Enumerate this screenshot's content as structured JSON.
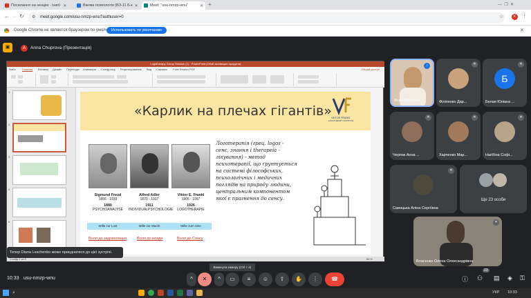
{
  "browser": {
    "tabs": [
      {
        "title": "Посилання на зенцію - ivanl·",
        "active": false,
        "color": "#d93025"
      },
      {
        "title": "Вікова психологія (ВЗ-11 Б.к",
        "active": false,
        "color": "#1a73e8"
      },
      {
        "title": "Meet: \"usu-nmzp-wnu\"",
        "active": true,
        "color": "#00897b"
      }
    ],
    "new_tab": "+",
    "url": "meet.google.com/usu-nmzp-wnu?authuser=0",
    "infobar": {
      "message": "Google Chrome не является браузером по умолчанию",
      "button": "Использовать по умолчанию"
    },
    "profile_letter": "К"
  },
  "meet": {
    "presenter_letter": "A",
    "presenter_label": "Anna Chuprova (Презентація)",
    "meeting_time": "10:33",
    "meeting_code": "usu-nmzp-wnu",
    "participants_count": "23",
    "toast": "Тепер Diana Leschenko може приєднатися до цієї зустрічі.",
    "tooltip": "Вимкнути камеру (Ctrl + e)",
    "more_people": "Ще 23 особи",
    "tiles": [
      {
        "name": "Anna Chuprova",
        "type": "video",
        "bg": "#d9c7b3"
      },
      {
        "name": "Філіпенко Дар...",
        "type": "photo",
        "bg": "#4a4f55"
      },
      {
        "name": "Белая Юліана ...",
        "type": "letter",
        "letter": "Б",
        "bg": "#1a73e8"
      },
      {
        "name": "Черпак Анна ...",
        "type": "photo",
        "bg": "#5b4c48"
      },
      {
        "name": "Харченко Мар...",
        "type": "photo",
        "bg": "#6b5548"
      },
      {
        "name": "Нагібіна Софі...",
        "type": "photo",
        "bg": "#7a6a58"
      },
      {
        "name": "Савоцька Аліна Сергіївна",
        "type": "photo",
        "bg": "#3d3a33"
      },
      {
        "name": "Власенко Олена Олександрівна",
        "type": "video",
        "bg": "#8a8478"
      }
    ]
  },
  "powerpoint": {
    "title": "Logotherapy Group Session (1) - PowerPoint (Сбой активации продукта)",
    "ribbon_tabs": [
      "Файл",
      "Главная",
      "Вставка",
      "Дизайн",
      "Переходы",
      "Анимация",
      "Слайд-шоу",
      "Рецензирование",
      "Вид",
      "Справка",
      "Foxit Reader PDF"
    ],
    "share": "Общий доступ",
    "slide_numbers": [
      "1",
      "2",
      "3",
      "4",
      "5"
    ],
    "status_left": "Слайд 2 из 9",
    "zoom": "85 %"
  },
  "slide": {
    "title": "«Карлик на плечах гігантів»",
    "logo_text": "VIKTOR FRANKL",
    "logo_sub": "LOGOTHERAPY INSTITUTE",
    "people": [
      {
        "name": "Sigmund Freud",
        "years": "1856 - 1939",
        "school_year": "1880",
        "school": "PSYCHOANALYSE",
        "will": "Wille zur Lust",
        "link": "Воля до задоволення"
      },
      {
        "name": "Alfred Adler",
        "years": "1870 - 1937",
        "school_year": "1911",
        "school": "INDIVIDUALPSYCHOLOGIE",
        "will": "Wille zur Macht",
        "link": "Воля до влади"
      },
      {
        "name": "Viktor E. Frankl",
        "years": "1905 - 1997",
        "school_year": "1926",
        "school": "LOGOTHERAPIE",
        "will": "Wille zum Sinn",
        "link": "Воля до Сенсу"
      }
    ],
    "quote": "Логотерапія (грец. logos - сенс, знання і therapeía - лікування) - метод психотерапії, що ґрунтується на системі філософських, психологічних і медичних поглядів на природу людини, центральним компонентом якої є прагнення до сенсу."
  },
  "controls": [
    "expand",
    "mic-off",
    "more",
    "camera",
    "captions",
    "emoji",
    "present",
    "raise-hand",
    "more-options",
    "leave"
  ],
  "taskbar": {
    "lang": "УКР",
    "time": "10:33"
  }
}
